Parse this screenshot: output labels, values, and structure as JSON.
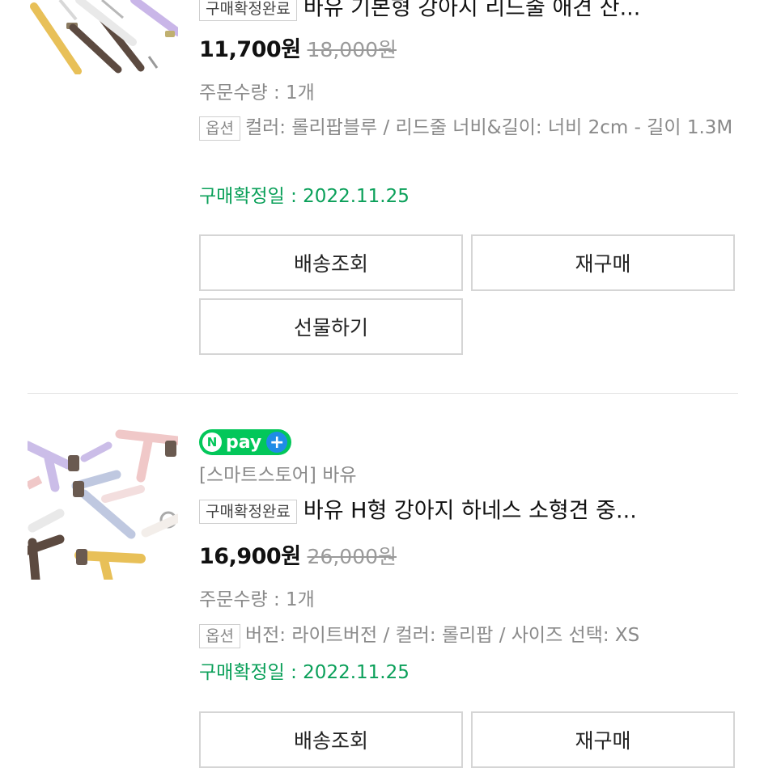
{
  "orders": [
    {
      "badge": "구매확정완료",
      "title": "바유 기본형 강아지 리드줄 애견 산...",
      "price": "11,700원",
      "original_price": "18,000원",
      "quantity": "주문수량 : 1개",
      "option_badge": "옵션",
      "option_text": "컬러: 롤리팝블루 / 리드줄 너비&길이: 너비 2cm - 길이 1.3M",
      "confirm_date": "구매확정일 : 2022.11.25",
      "buttons": {
        "track": "배송조회",
        "rebuy": "재구매",
        "gift": "선물하기"
      }
    },
    {
      "npay_label": "pay",
      "npay_n": "N",
      "npay_plus": "+",
      "store": "[스마트스토어] 바유",
      "badge": "구매확정완료",
      "title": "바유 H형 강아지 하네스 소형견 중...",
      "price": "16,900원",
      "original_price": "26,000원",
      "quantity": "주문수량 : 1개",
      "option_badge": "옵션",
      "option_text": "버전: 라이트버전 / 컬러: 롤리팝 / 사이즈 선택: XS",
      "confirm_date": "구매확정일 : 2022.11.25",
      "buttons": {
        "track": "배송조회",
        "rebuy": "재구매"
      }
    }
  ],
  "colors": {
    "confirm_green": "#0ba05a",
    "npay_green": "#03c75a",
    "npay_blue": "#1f8ce6"
  }
}
